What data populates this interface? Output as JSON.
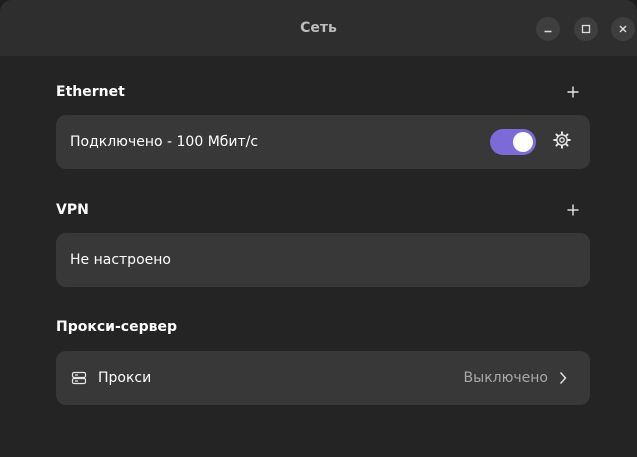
{
  "window": {
    "title": "Сеть"
  },
  "ethernet": {
    "heading": "Ethernet",
    "status_label": "Подключено - 100 Мбит/с",
    "toggle_on": true
  },
  "vpn": {
    "heading": "VPN",
    "status_label": "Не настроено"
  },
  "proxy": {
    "heading": "Прокси-сервер",
    "row_label": "Прокси",
    "row_value": "Выключено"
  },
  "colors": {
    "accent": "#7c6bd6",
    "card_bg": "#383838",
    "window_bg": "#242424",
    "titlebar_bg": "#2e2e2e"
  },
  "icons": {
    "window_minimize": "minimize-icon",
    "window_maximize": "maximize-icon",
    "window_close": "close-icon",
    "add": "plus-icon",
    "settings": "gear-icon",
    "proxy": "server-icon",
    "row_chevron": "chevron-right-icon"
  }
}
